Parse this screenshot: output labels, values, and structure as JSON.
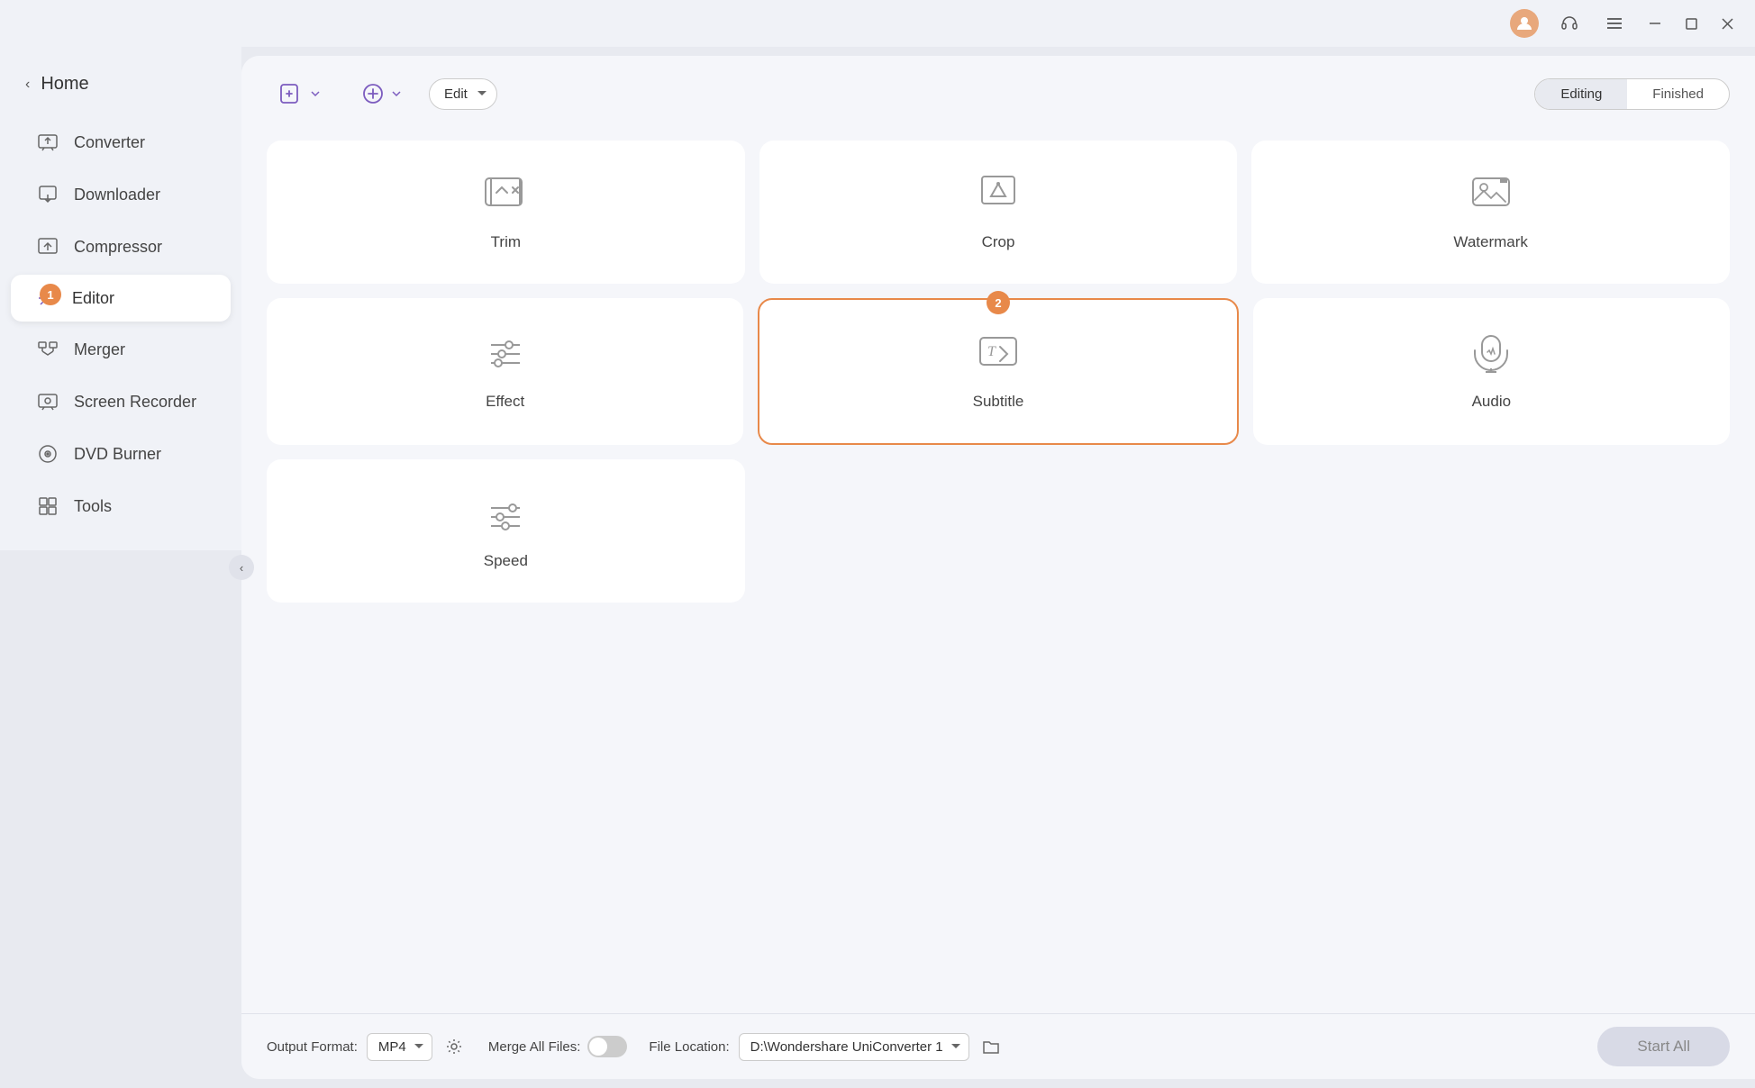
{
  "titlebar": {
    "user_icon": "👤",
    "notif_icon": "🎧",
    "menu_icon": "☰",
    "minimize": "—",
    "maximize": "□",
    "close": "✕"
  },
  "sidebar": {
    "home_label": "Home",
    "items": [
      {
        "id": "converter",
        "label": "Converter",
        "icon": "converter"
      },
      {
        "id": "downloader",
        "label": "Downloader",
        "icon": "downloader"
      },
      {
        "id": "compressor",
        "label": "Compressor",
        "icon": "compressor"
      },
      {
        "id": "editor",
        "label": "Editor",
        "icon": "editor",
        "active": true,
        "badge": "1"
      },
      {
        "id": "merger",
        "label": "Merger",
        "icon": "merger"
      },
      {
        "id": "screen-recorder",
        "label": "Screen Recorder",
        "icon": "screen-recorder"
      },
      {
        "id": "dvd-burner",
        "label": "DVD Burner",
        "icon": "dvd-burner"
      },
      {
        "id": "tools",
        "label": "Tools",
        "icon": "tools"
      }
    ]
  },
  "toolbar": {
    "add_btn1_label": "",
    "add_btn2_label": "",
    "edit_select_value": "Edit",
    "edit_options": [
      "Edit"
    ],
    "tab_editing": "Editing",
    "tab_finished": "Finished"
  },
  "grid": {
    "cards": [
      [
        {
          "id": "trim",
          "label": "Trim",
          "icon": "trim",
          "highlighted": false,
          "badge": null
        },
        {
          "id": "crop",
          "label": "Crop",
          "icon": "crop",
          "highlighted": false,
          "badge": null
        },
        {
          "id": "watermark",
          "label": "Watermark",
          "icon": "watermark",
          "highlighted": false,
          "badge": null
        }
      ],
      [
        {
          "id": "effect",
          "label": "Effect",
          "icon": "effect",
          "highlighted": false,
          "badge": null
        },
        {
          "id": "subtitle",
          "label": "Subtitle",
          "icon": "subtitle",
          "highlighted": true,
          "badge": "2"
        },
        {
          "id": "audio",
          "label": "Audio",
          "icon": "audio",
          "highlighted": false,
          "badge": null
        }
      ],
      [
        {
          "id": "speed",
          "label": "Speed",
          "icon": "speed",
          "highlighted": false,
          "badge": null
        },
        {
          "id": "empty1",
          "label": "",
          "icon": "",
          "empty": true
        },
        {
          "id": "empty2",
          "label": "",
          "icon": "",
          "empty": true
        }
      ]
    ]
  },
  "bottom": {
    "output_format_label": "Output Format:",
    "output_format_value": "MP4",
    "file_location_label": "File Location:",
    "file_location_value": "D:\\Wondershare UniConverter 1",
    "merge_label": "Merge All Files:",
    "start_all_label": "Start All"
  }
}
